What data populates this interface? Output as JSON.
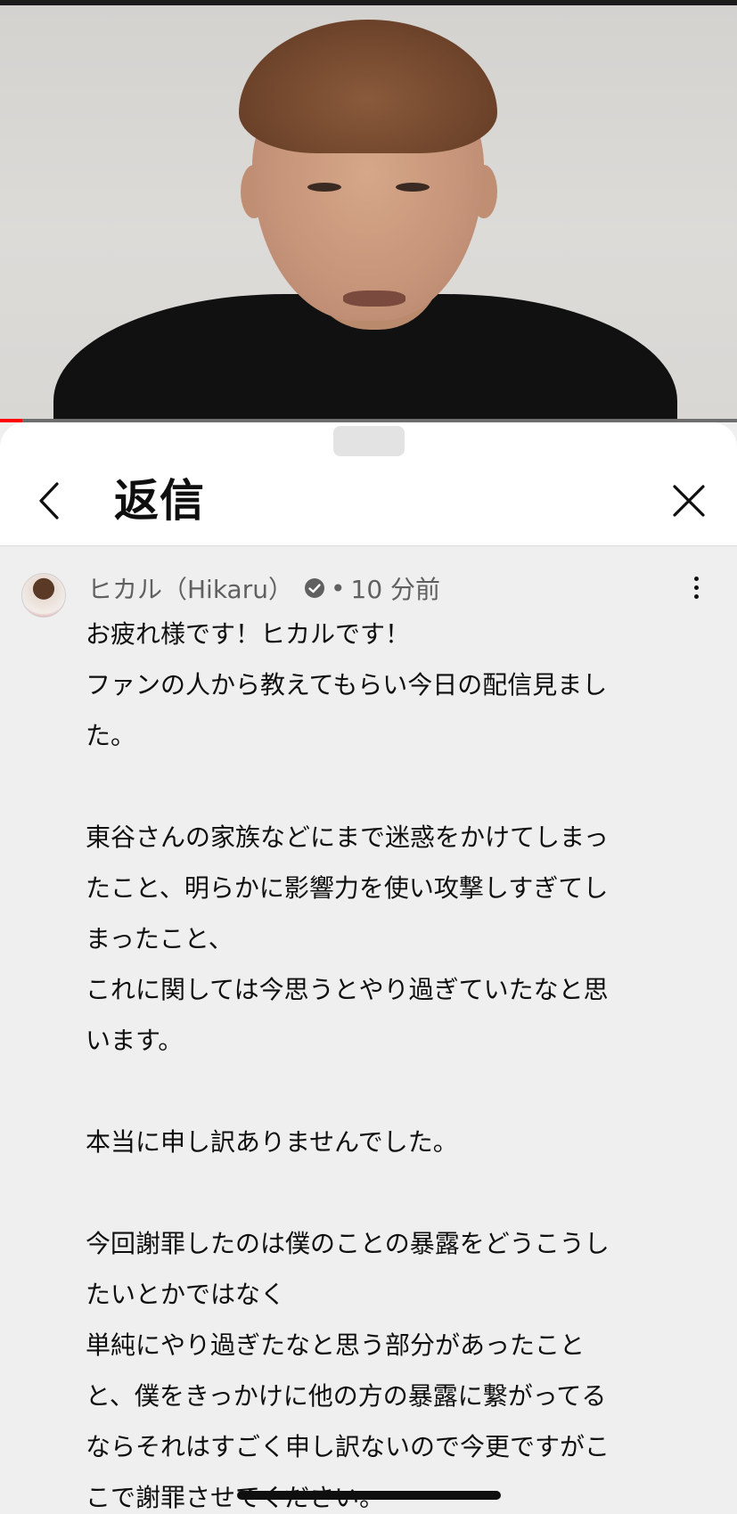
{
  "header": {
    "title": "返信",
    "back_icon": "chevron-left-icon",
    "close_icon": "close-icon"
  },
  "video": {
    "progress_fraction": 0.03,
    "progress_color": "#ff0000"
  },
  "comment": {
    "author": "ヒカル（Hikaru）",
    "verified_icon": "verified-check-icon",
    "separator": "•",
    "time": "10 分前",
    "menu_icon": "more-vert-icon",
    "lines": [
      "お疲れ様です！ヒカルです！",
      "ファンの人から教えてもらい今日の配信見まし",
      "た。",
      "",
      "東谷さんの家族などにまで迷惑をかけてしまっ",
      "たこと、明らかに影響力を使い攻撃しすぎてし",
      "まったこと、",
      "これに関しては今思うとやり過ぎていたなと思",
      "います。",
      "",
      "本当に申し訳ありませんでした。",
      "",
      "今回謝罪したのは僕のことの暴露をどうこうし",
      "たいとかではなく",
      "単純にやり過ぎたなと思う部分があったこと",
      "と、僕をきっかけに他の方の暴露に繋がってる",
      "ならそれはすごく申し訳ないので今更ですがこ",
      "こで謝罪させてください。"
    ]
  },
  "colors": {
    "sheet_bg": "#ffffff",
    "comment_bg": "#efefef",
    "meta_text": "#606060",
    "body_text": "#0f0f0f"
  }
}
